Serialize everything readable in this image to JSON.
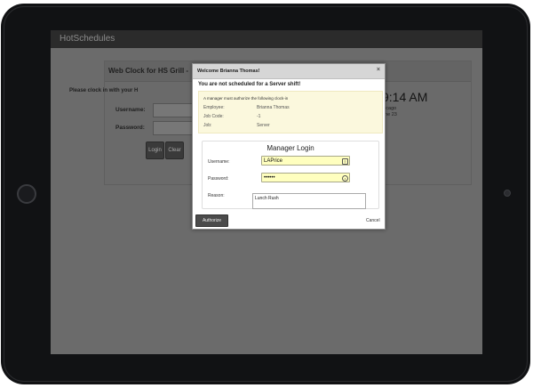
{
  "app": {
    "title": "HotSchedules"
  },
  "web_clock": {
    "title": "Web Clock for HS Grill - ",
    "prompt": "Please clock in with your H",
    "username_label": "Username:",
    "password_label": "Password:",
    "login_label": "Login",
    "clear_label": "Clear",
    "time": "9:14 AM",
    "location": "hicago",
    "date": "une 23"
  },
  "modal": {
    "title": "Welcome Brianna Thomas!",
    "close_icon": "×",
    "warning": "You are not scheduled for a Server shift!",
    "info": {
      "heading": "A manager must authorize the following clock-in",
      "rows": [
        {
          "label": "Employee:",
          "value": "Brianna Thomas"
        },
        {
          "label": "Job Code:",
          "value": "-1"
        },
        {
          "label": "Job:",
          "value": "Server"
        }
      ]
    },
    "login": {
      "title": "Manager Login",
      "username_label": "Username:",
      "username_value": "LAPrice",
      "password_label": "Password:",
      "password_value": "••••••",
      "reason_label": "Reason:",
      "reason_value": "Lunch Rush"
    },
    "authorize_label": "Authorize",
    "cancel_label": "Cancel"
  },
  "icons": {
    "contact_card": "contact-card-icon",
    "key": "key-icon"
  },
  "colors": {
    "field_highlight": "#ffffbf",
    "info_box": "#fbf8dd",
    "appbar": "#2b2b2b",
    "overlay": "#6b6b6b"
  }
}
